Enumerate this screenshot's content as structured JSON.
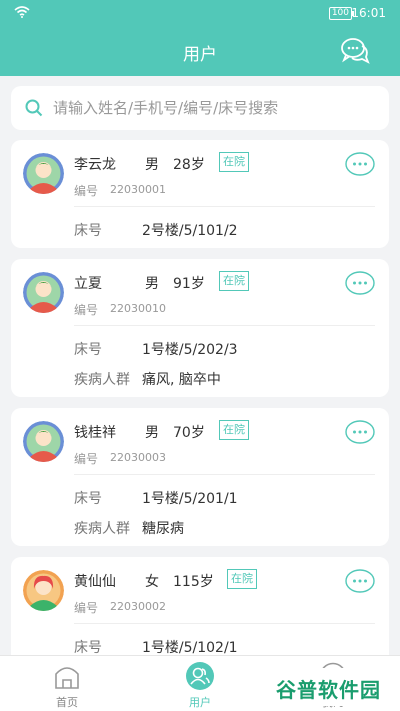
{
  "status": {
    "time": "16:01",
    "battery": "100"
  },
  "header": {
    "title": "用户"
  },
  "search": {
    "placeholder": "请输入姓名/手机号/编号/床号搜索"
  },
  "labels": {
    "code": "编号",
    "bed": "床号",
    "disease": "疾病人群"
  },
  "patients": [
    {
      "name": "李云龙",
      "gender": "男",
      "age": "28岁",
      "status": "在院",
      "code": "22030001",
      "bed": "2号楼/5/101/2",
      "disease": ""
    },
    {
      "name": "立夏",
      "gender": "男",
      "age": "91岁",
      "status": "在院",
      "code": "22030010",
      "bed": "1号楼/5/202/3",
      "disease": "痛风, 脑卒中"
    },
    {
      "name": "钱桂祥",
      "gender": "男",
      "age": "70岁",
      "status": "在院",
      "code": "22030003",
      "bed": "1号楼/5/201/1",
      "disease": "糖尿病"
    },
    {
      "name": "黄仙仙",
      "gender": "女",
      "age": "115岁",
      "status": "在院",
      "code": "22030002",
      "bed": "1号楼/5/102/1",
      "disease": ""
    }
  ],
  "tabs": [
    {
      "label": "首页"
    },
    {
      "label": "用户"
    },
    {
      "label": "我的"
    }
  ],
  "watermark": {
    "text": "谷普软件园"
  },
  "colors": {
    "accent": "#52c8b8",
    "male_avatar_ring": "#6a8fd6",
    "female_avatar_bg": "#f2a251"
  }
}
